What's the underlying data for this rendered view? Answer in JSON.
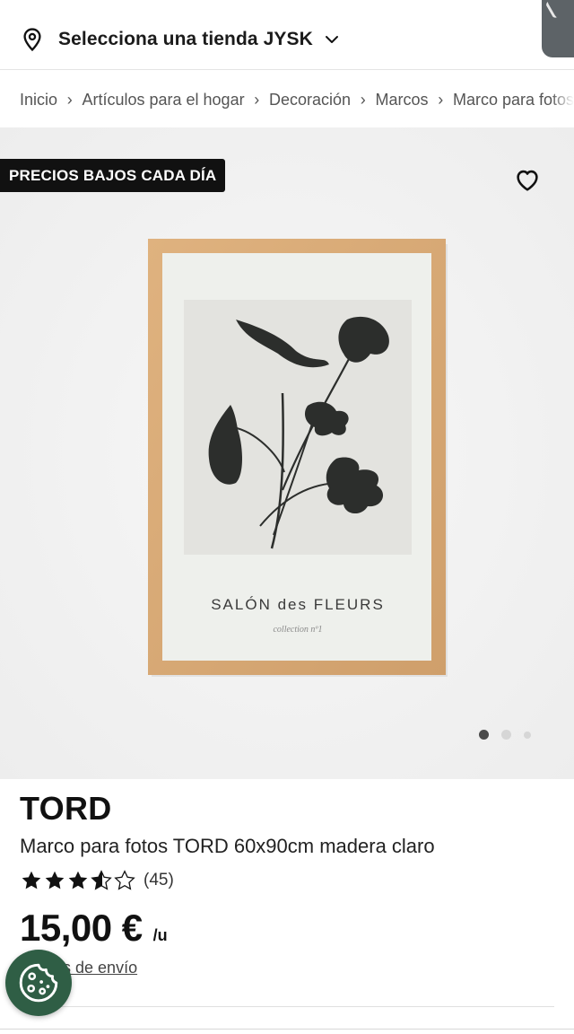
{
  "header": {
    "store_label": "Selecciona una tienda JYSK",
    "icons": [
      "location-pin-icon",
      "chevron-down-icon"
    ]
  },
  "breadcrumb": {
    "items": [
      "Inicio",
      "Artículos para el hogar",
      "Decoración",
      "Marcos",
      "Marco para fotos"
    ],
    "separator": "›"
  },
  "gallery": {
    "badge": "PRECIOS BAJOS CADA DÍA",
    "image": {
      "poster_title": "SALÓN des FLEURS",
      "poster_subtitle": "collection nº1"
    },
    "slides": 3,
    "active_slide": 1,
    "favorite_icon": "heart-outline-icon"
  },
  "product": {
    "brand": "TORD",
    "title": "Marco para fotos TORD 60x90cm madera claro",
    "rating": {
      "value": 3.5,
      "max": 5,
      "count_label": "(45)"
    },
    "price": "15,00 €",
    "unit": "/u",
    "shipping_link": "Gastos de envío"
  },
  "colors": {
    "badge_bg": "#111111",
    "frame_wood": "#d9ab78",
    "cookie_bg": "#2f5e45",
    "star": "#111111"
  }
}
